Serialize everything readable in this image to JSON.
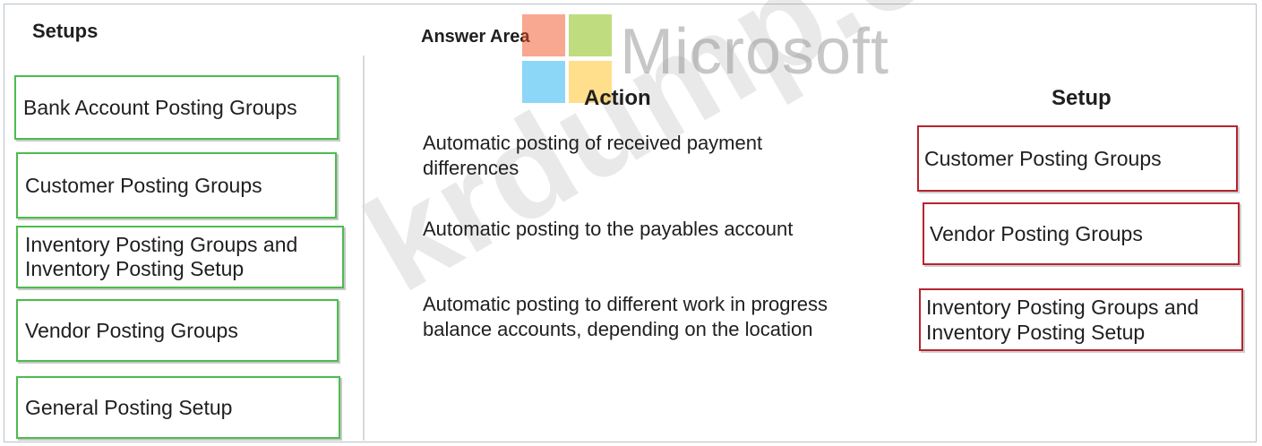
{
  "setups": {
    "heading": "Setups",
    "items": [
      "Bank Account Posting Groups",
      "Customer Posting Groups",
      "Inventory Posting Groups and Inventory Posting Setup",
      "Vendor Posting Groups",
      "General Posting Setup"
    ]
  },
  "answer_area": {
    "heading": "Answer Area",
    "action_header": "Action",
    "setup_header": "Setup",
    "rows": [
      {
        "action": "Automatic posting of received payment differences",
        "setup": "Customer Posting Groups"
      },
      {
        "action": "Automatic posting to the payables account",
        "setup": "Vendor Posting Groups"
      },
      {
        "action": "Automatic posting to different work in progress balance accounts, depending on the location",
        "setup": "Inventory Posting Groups and Inventory Posting Setup"
      }
    ]
  },
  "watermark": {
    "brand": "Microsoft",
    "site": "krdump.com"
  },
  "colors": {
    "source_border": "#4cbc4c",
    "target_border": "#b5242f",
    "logo_red": "#f25022",
    "logo_green": "#7fba00",
    "logo_blue": "#00a4ef",
    "logo_yellow": "#ffb900"
  }
}
